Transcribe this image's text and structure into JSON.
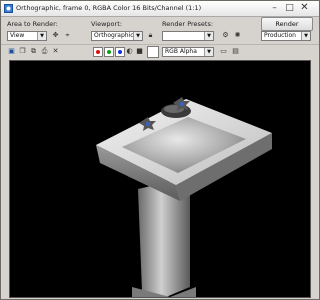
{
  "window": {
    "title": "Orthographic, frame 0, RGBA Color 16 Bits/Channel (1:1)",
    "controls": {
      "minimize": "–",
      "maximize": "□",
      "close": "✕"
    }
  },
  "area_to_render": {
    "label": "Area to Render:",
    "value": "View"
  },
  "viewport_select": {
    "label": "Viewport:",
    "value": "Orthographic"
  },
  "render_presets": {
    "label": "Render Presets:",
    "value": ""
  },
  "render_button": {
    "label": "Render"
  },
  "production_select": {
    "value": "Production"
  },
  "channel_select": {
    "value": "RGB Alpha"
  },
  "channel_swatches": {
    "red": "#e01010",
    "green": "#10a010",
    "blue": "#1030e0"
  },
  "icons": {
    "save": "save-icon",
    "copy": "copy-icon",
    "clone": "clone-icon",
    "print": "print-icon",
    "clear": "clear-icon",
    "lock": "lock-icon",
    "settings": "settings-icon",
    "environment": "environment-icon"
  }
}
